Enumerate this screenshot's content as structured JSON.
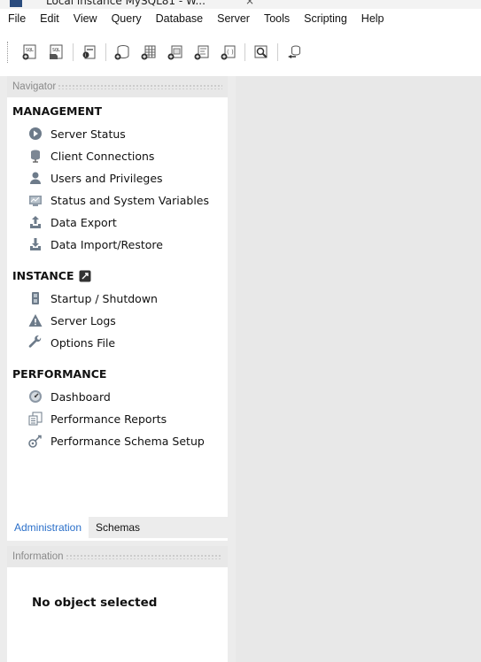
{
  "window": {
    "tab_title": "Local instance MySQL81 - W...",
    "close_glyph": "×"
  },
  "menu": [
    "File",
    "Edit",
    "View",
    "Query",
    "Database",
    "Server",
    "Tools",
    "Scripting",
    "Help"
  ],
  "toolbar": {
    "buttons": [
      {
        "name": "new-sql-tab-icon"
      },
      {
        "name": "open-sql-script-icon"
      },
      {
        "name": "inspector-icon"
      },
      {
        "name": "create-schema-icon"
      },
      {
        "name": "create-table-icon"
      },
      {
        "name": "create-view-icon"
      },
      {
        "name": "create-procedure-icon"
      },
      {
        "name": "create-function-icon"
      },
      {
        "name": "search-table-data-icon"
      },
      {
        "name": "reconnect-icon"
      }
    ]
  },
  "navigator": {
    "header": "Navigator",
    "management": {
      "title": "MANAGEMENT",
      "items": [
        {
          "label": "Server Status",
          "icon": "server-status-icon"
        },
        {
          "label": "Client Connections",
          "icon": "client-connections-icon"
        },
        {
          "label": "Users and Privileges",
          "icon": "users-icon"
        },
        {
          "label": "Status and System Variables",
          "icon": "variables-icon"
        },
        {
          "label": "Data Export",
          "icon": "data-export-icon"
        },
        {
          "label": "Data Import/Restore",
          "icon": "data-import-icon"
        }
      ]
    },
    "instance": {
      "title": "INSTANCE",
      "items": [
        {
          "label": "Startup / Shutdown",
          "icon": "startup-icon"
        },
        {
          "label": "Server Logs",
          "icon": "warning-icon"
        },
        {
          "label": "Options File",
          "icon": "wrench-icon"
        }
      ]
    },
    "performance": {
      "title": "PERFORMANCE",
      "items": [
        {
          "label": "Dashboard",
          "icon": "dashboard-icon"
        },
        {
          "label": "Performance Reports",
          "icon": "reports-icon"
        },
        {
          "label": "Performance Schema Setup",
          "icon": "schema-setup-icon"
        }
      ]
    }
  },
  "bottom_tabs": [
    {
      "label": "Administration",
      "active": true
    },
    {
      "label": "Schemas",
      "active": false
    }
  ],
  "information": {
    "header": "Information",
    "empty_text": "No object selected"
  },
  "colors": {
    "active_tab_text": "#2a6fc9",
    "panel_header_bg": "#e8e8e8",
    "main_bg": "#e8e8e8"
  }
}
